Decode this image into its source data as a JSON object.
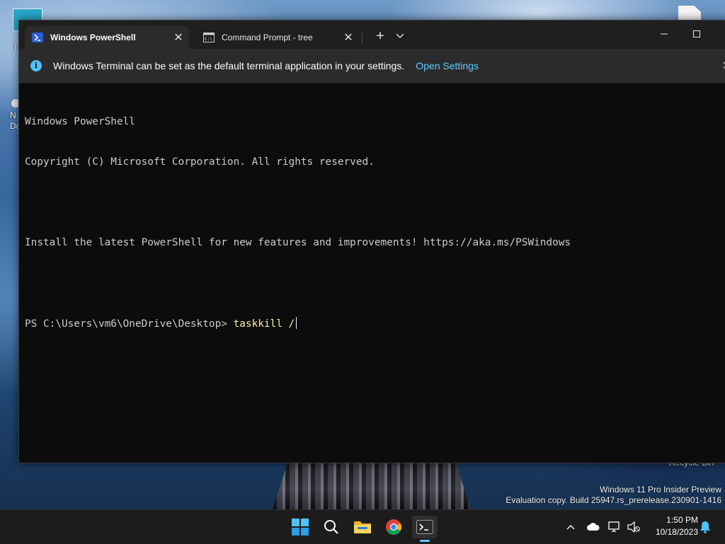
{
  "desktop": {
    "icon1_label": "T",
    "icon2_label_line1": "N",
    "icon2_label_line2": "Do",
    "recycle_bin_label": "Recycle Bin",
    "watermark_line1": "Windows 11 Pro Insider Preview",
    "watermark_line2": "Evaluation copy. Build 25947.rs_prerelease.230901-1416"
  },
  "window": {
    "tabs": [
      {
        "title": "Windows PowerShell",
        "icon": "powershell-icon",
        "active": true
      },
      {
        "title": "Command Prompt - tree",
        "icon": "cmd-icon",
        "active": false
      }
    ],
    "new_tab_symbol": "+",
    "infobar": {
      "message": "Windows Terminal can be set as the default terminal application in your settings.",
      "link": "Open Settings"
    },
    "console": {
      "line1": "Windows PowerShell",
      "line2": "Copyright (C) Microsoft Corporation. All rights reserved.",
      "line3": "Install the latest PowerShell for new features and improvements! https://aka.ms/PSWindows",
      "prompt": "PS C:\\Users\\vm6\\OneDrive\\Desktop> ",
      "command": "taskkill /"
    }
  },
  "taskbar": {
    "pinned": [
      "windows-start-icon",
      "search-icon",
      "file-explorer-icon",
      "chrome-icon",
      "terminal-icon"
    ],
    "clock_time": "1:50 PM",
    "clock_date": "10/18/2023"
  },
  "colors": {
    "terminal_bg": "#0c0c0c",
    "command_text": "#f9f1a5",
    "link": "#60cdff",
    "info_icon": "#4cc2ff"
  }
}
